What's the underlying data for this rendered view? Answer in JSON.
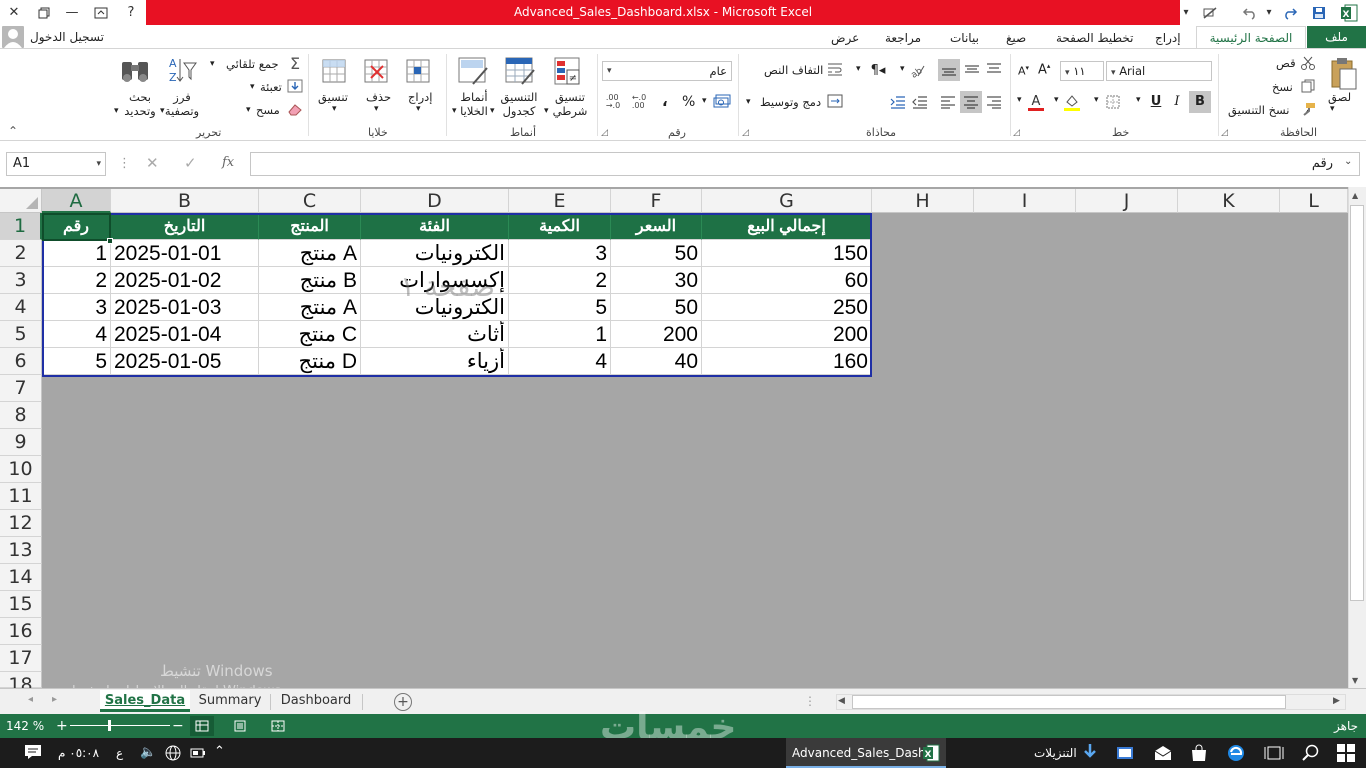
{
  "window": {
    "title": "Advanced_Sales_Dashboard.xlsx -  Microsoft Excel",
    "title_color": "#e81123"
  },
  "account": {
    "signin": "تسجيل الدخول"
  },
  "tabs": [
    "ملف",
    "الصفحة الرئيسية",
    "إدراج",
    "تخطيط الصفحة",
    "صيغ",
    "بيانات",
    "مراجعة",
    "عرض"
  ],
  "ribbon": {
    "clipboard": {
      "label": "الحافظة",
      "paste": "لصق",
      "cut": "قص",
      "copy": "نسخ",
      "format_painter": "نسخ التنسيق"
    },
    "font": {
      "label": "خط",
      "font_name": "Arial",
      "font_size": "١١",
      "bold": "B",
      "italic": "I",
      "underline": "U"
    },
    "alignment": {
      "label": "محاذاة",
      "wrap_text": "التفاف النص",
      "merge_center": "دمج وتوسيط"
    },
    "number": {
      "label": "رقم",
      "format": "عام",
      "percent": "%",
      "comma": "،"
    },
    "styles": {
      "label": "أنماط",
      "conditional": "تنسيق شرطي",
      "as_table": "التنسيق كجدول",
      "cell_styles": "أنماط الخلايا"
    },
    "cells": {
      "label": "خلايا",
      "insert": "إدراج",
      "delete": "حذف",
      "format": "تنسيق"
    },
    "editing": {
      "label": "تحرير",
      "autosum": "جمع تلقائي",
      "fill": "تعبئة",
      "clear": "مسح",
      "sort_filter": "فرز وتصفية",
      "find_select": "بحث وتحديد"
    }
  },
  "formula_bar": {
    "name_box": "A1",
    "fx": "fx",
    "content": "رقم"
  },
  "columns": [
    "A",
    "B",
    "C",
    "D",
    "E",
    "F",
    "G",
    "H",
    "I",
    "J",
    "K",
    "L"
  ],
  "rows": [
    "1",
    "2",
    "3",
    "4",
    "5",
    "6",
    "7",
    "8",
    "9",
    "10",
    "11",
    "12",
    "13",
    "14",
    "15",
    "16",
    "17",
    "18"
  ],
  "table": {
    "headers": [
      "رقم",
      "التاريخ",
      "المنتج",
      "الفئة",
      "الكمية",
      "السعر",
      "إجمالي البيع"
    ],
    "rows": [
      [
        "1",
        "2025-01-01",
        "منتج A",
        "الكترونيات",
        "3",
        "50",
        "150"
      ],
      [
        "2",
        "2025-01-02",
        "منتج B",
        "إكسسوارات",
        "2",
        "30",
        "60"
      ],
      [
        "3",
        "2025-01-03",
        "منتج A",
        "الكترونيات",
        "5",
        "50",
        "250"
      ],
      [
        "4",
        "2025-01-04",
        "منتج C",
        "أثاث",
        "1",
        "200",
        "200"
      ],
      [
        "5",
        "2025-01-05",
        "منتج D",
        "أزياء",
        "4",
        "40",
        "160"
      ]
    ],
    "header_color": "#1e7145"
  },
  "watermark_page": "صفحة ١",
  "activation": {
    "line1": "تنشيط Windows",
    "line2": "انتقل إلى الإعدادات لتنشيط Windows."
  },
  "sheets": [
    "Sales_Data",
    "Summary",
    "Dashboard"
  ],
  "active_sheet": "Sales_Data",
  "status": {
    "ready": "جاهز",
    "zoom": "142 %"
  },
  "brand_watermark": "خمسات",
  "taskbar": {
    "app": "Advanced_Sales_Dash...",
    "downloads": "التنزيلات",
    "time": "٠٥:٠٨ م",
    "lang": "ع"
  },
  "accent": "#217346"
}
